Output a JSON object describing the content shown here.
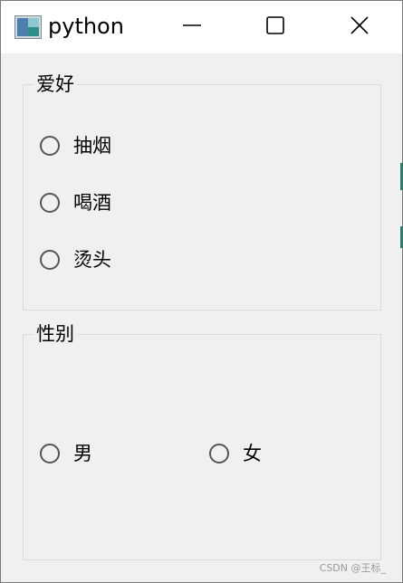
{
  "window": {
    "title": "python"
  },
  "hobby_group": {
    "title": "爱好",
    "options": [
      {
        "label": "抽烟",
        "checked": false
      },
      {
        "label": "喝酒",
        "checked": false
      },
      {
        "label": "烫头",
        "checked": false
      }
    ]
  },
  "gender_group": {
    "title": "性别",
    "options": [
      {
        "label": "男",
        "checked": false
      },
      {
        "label": "女",
        "checked": false
      }
    ]
  },
  "watermark": "CSDN @王标_",
  "icons": {
    "app": "python-window-icon",
    "minimize": "minimize-icon",
    "maximize": "maximize-icon",
    "close": "close-icon"
  }
}
